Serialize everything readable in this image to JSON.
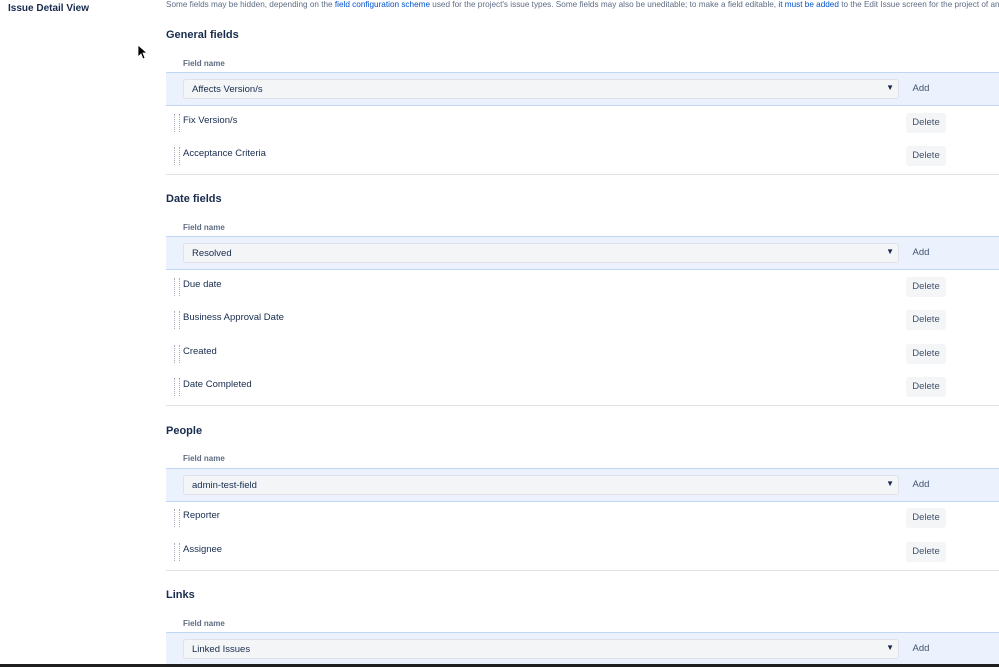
{
  "sidebar": {
    "title": "Issue Detail View"
  },
  "info": {
    "text_1": "Some fields may be hidden, depending on the ",
    "link_1": "field configuration scheme",
    "text_2": " used for the project's issue types. Some fields may also be uneditable; to make a field editable, ",
    "link_2": "it must be added",
    "text_3": " to the Edit Issue screen for the project of an"
  },
  "labels": {
    "field_name": "Field name",
    "add": "Add",
    "delete": "Delete"
  },
  "sections": {
    "general": {
      "title": "General fields",
      "selected": "Affects Version/s",
      "fields": [
        "Fix Version/s",
        "Acceptance Criteria"
      ]
    },
    "date": {
      "title": "Date fields",
      "selected": "Resolved",
      "fields": [
        "Due date",
        "Business Approval Date",
        "Created",
        "Date Completed"
      ]
    },
    "people": {
      "title": "People",
      "selected": "admin-test-field",
      "fields": [
        "Reporter",
        "Assignee"
      ]
    },
    "links": {
      "title": "Links",
      "selected": "Linked Issues",
      "fields": []
    }
  }
}
